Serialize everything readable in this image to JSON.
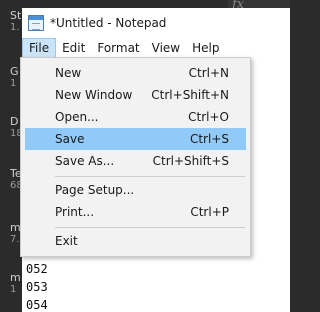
{
  "background": {
    "left_items": [
      {
        "title": "St",
        "sub": "1."
      },
      {
        "title": "G",
        "sub": "1"
      },
      {
        "title": "D",
        "sub": "18"
      },
      {
        "title": "Te",
        "sub": "68"
      },
      {
        "title": "m",
        "sub": "7."
      },
      {
        "title": "m",
        "sub": "1"
      }
    ],
    "fx_label": "fx"
  },
  "window": {
    "title": "*Untitled - Notepad",
    "menus": [
      "File",
      "Edit",
      "Format",
      "View",
      "Help"
    ],
    "active_menu": "File",
    "text_lines": [
      "052",
      "053",
      "054"
    ]
  },
  "file_menu": {
    "items": [
      {
        "label": "New",
        "shortcut": "Ctrl+N"
      },
      {
        "label": "New Window",
        "shortcut": "Ctrl+Shift+N"
      },
      {
        "label": "Open...",
        "shortcut": "Ctrl+O"
      },
      {
        "label": "Save",
        "shortcut": "Ctrl+S",
        "highlighted": true
      },
      {
        "label": "Save As...",
        "shortcut": "Ctrl+Shift+S"
      },
      {
        "label": "Page Setup...",
        "shortcut": ""
      },
      {
        "label": "Print...",
        "shortcut": "Ctrl+P"
      },
      {
        "label": "Exit",
        "shortcut": ""
      }
    ]
  },
  "colors": {
    "highlight": "#91c9f7",
    "active_menu_bg": "#cce4f7",
    "dark_bg": "#2b2b2b"
  }
}
